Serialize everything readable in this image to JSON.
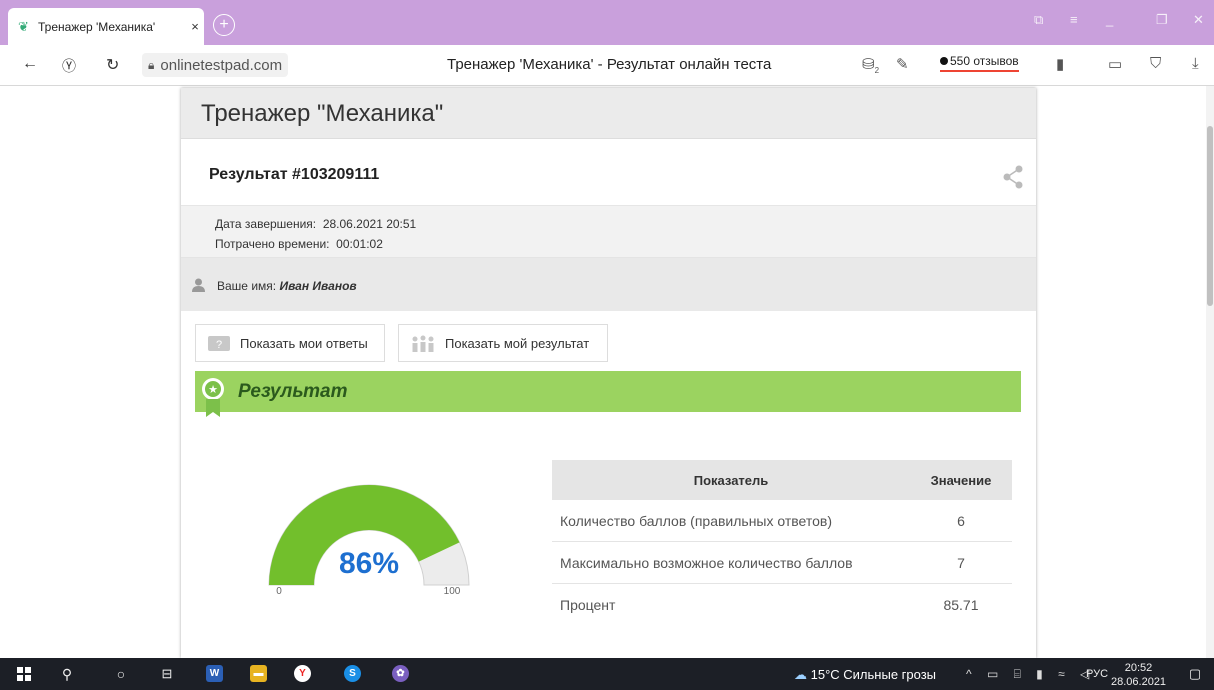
{
  "browser": {
    "tab_title": "Тренажер 'Механика'",
    "tab_close": "×",
    "new_tab": "+",
    "url": "onlinetestpad.com",
    "page_title": "Тренажер 'Механика' - Результат онлайн теста",
    "ext_badge": "2",
    "reviews_label": "550 отзывов"
  },
  "page": {
    "test_title": "Тренажер \"Механика\"",
    "result_title": "Результат #103209111",
    "completion_label": "Дата завершения:",
    "completion_value": "28.06.2021 20:51",
    "time_label": "Потрачено времени:",
    "time_value": "00:01:02",
    "name_label": "Ваше имя:",
    "name_value": "Иван Иванов",
    "btn_answers": "Показать мои ответы",
    "btn_result": "Показать мой результат",
    "section_title": "Результат"
  },
  "gauge": {
    "percent_text": "86%",
    "value": 86,
    "min_label": "0",
    "max_label": "100",
    "fill_color": "#72bf2c",
    "empty_color": "#ececec"
  },
  "stats": {
    "headers": [
      "Показатель",
      "Значение"
    ],
    "rows": [
      {
        "label": "Количество баллов (правильных ответов)",
        "value": "6"
      },
      {
        "label": "Максимально возможное количество баллов",
        "value": "7"
      },
      {
        "label": "Процент",
        "value": "85.71"
      }
    ]
  },
  "taskbar": {
    "weather": "15°C  Сильные грозы",
    "lang": "РУС",
    "time": "20:52",
    "date": "28.06.2021"
  },
  "colors": {
    "accent_tab": "#c9a0dc",
    "banner": "#9bd360",
    "banner_text": "#2b5a1d",
    "percent_text": "#1d6fd0"
  }
}
